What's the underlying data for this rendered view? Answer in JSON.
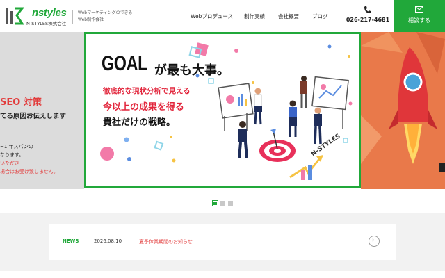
{
  "brand": {
    "logo_text": "nstyles",
    "company": "N-STYLES株式会社",
    "tagline_line1": "Webマーケティングのできる",
    "tagline_line2": "Web制作会社",
    "accent_color": "#21a83a"
  },
  "nav": {
    "items": [
      {
        "label": "Webプロデュース"
      },
      {
        "label": "制作実績"
      },
      {
        "label": "会社概要"
      },
      {
        "label": "ブログ"
      }
    ]
  },
  "contact": {
    "phone_icon": "phone-icon",
    "phone": "026-217-4681",
    "consult_icon": "mail-icon",
    "consult_label": "相談する"
  },
  "hero": {
    "prev_slide": {
      "line1": "SEO 対策",
      "line2": "てる原因お伝えします",
      "line3": "~1 年スパンの",
      "line4": "なります。",
      "line5": "いただき",
      "line6": "場合はお受け致しません。"
    },
    "main_slide": {
      "headline_en": "GOAL",
      "headline_jp": "が最も大事。",
      "line1": "徹底的な現状分析で見える",
      "line2": "今以上の成果を得る",
      "line3": "貴社だけの戦略。",
      "badge": "N-STYLES"
    },
    "pagination": {
      "count": 3,
      "active": 1
    }
  },
  "news": {
    "label": "NEWS",
    "date": "2026.08.10",
    "title": "夏季休業期間のお知らせ",
    "arrow_icon": "chevron-right-icon"
  }
}
